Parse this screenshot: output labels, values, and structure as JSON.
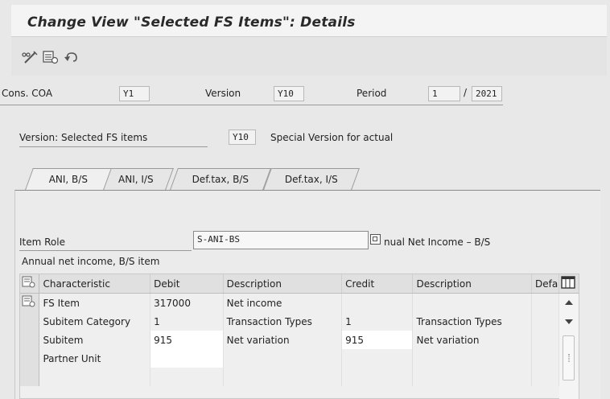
{
  "window": {
    "title": "Change View \"Selected FS Items\": Details"
  },
  "toolbar": {
    "icons": [
      "display-change-icon",
      "select-all-icon",
      "undo-icon"
    ]
  },
  "header": {
    "cons_coa_label": "Cons. COA",
    "cons_coa_value": "Y1",
    "version_label": "Version",
    "version_value": "Y10",
    "period_label": "Period",
    "period_value": "1",
    "period_separator": "/",
    "year_value": "2021"
  },
  "version_block": {
    "label": "Version: Selected FS items",
    "value": "Y10",
    "description": "Special Version for actual"
  },
  "tabs": [
    {
      "label": "ANI, B/S"
    },
    {
      "label": "ANI, I/S"
    },
    {
      "label": "Def.tax, B/S"
    },
    {
      "label": "Def.tax, I/S"
    }
  ],
  "item_role": {
    "label": "Item Role",
    "value": "S-ANI-BS",
    "description": "nual Net Income – B/S",
    "subtitle": "Annual net income, B/S item"
  },
  "grid": {
    "columns": [
      "Characteristic",
      "Debit",
      "Description",
      "Credit",
      "Description",
      "Defa"
    ],
    "rows": [
      {
        "characteristic": "FS Item",
        "debit": "317000",
        "debit_desc": "Net income",
        "credit": "",
        "credit_desc": ""
      },
      {
        "characteristic": "Subitem Category",
        "debit": "1",
        "debit_desc": "Transaction Types",
        "credit": "1",
        "credit_desc": "Transaction Types"
      },
      {
        "characteristic": "Subitem",
        "debit": "915",
        "debit_desc": "Net variation",
        "credit": "915",
        "credit_desc": "Net variation"
      },
      {
        "characteristic": "Partner Unit",
        "debit": "",
        "debit_desc": "",
        "credit": "",
        "credit_desc": ""
      }
    ]
  },
  "colors": {
    "background": "#e8e8e8",
    "title_bar": "#f4f4f4",
    "input_bg": "#f2f2f2",
    "cell_white": "#ffffff"
  }
}
